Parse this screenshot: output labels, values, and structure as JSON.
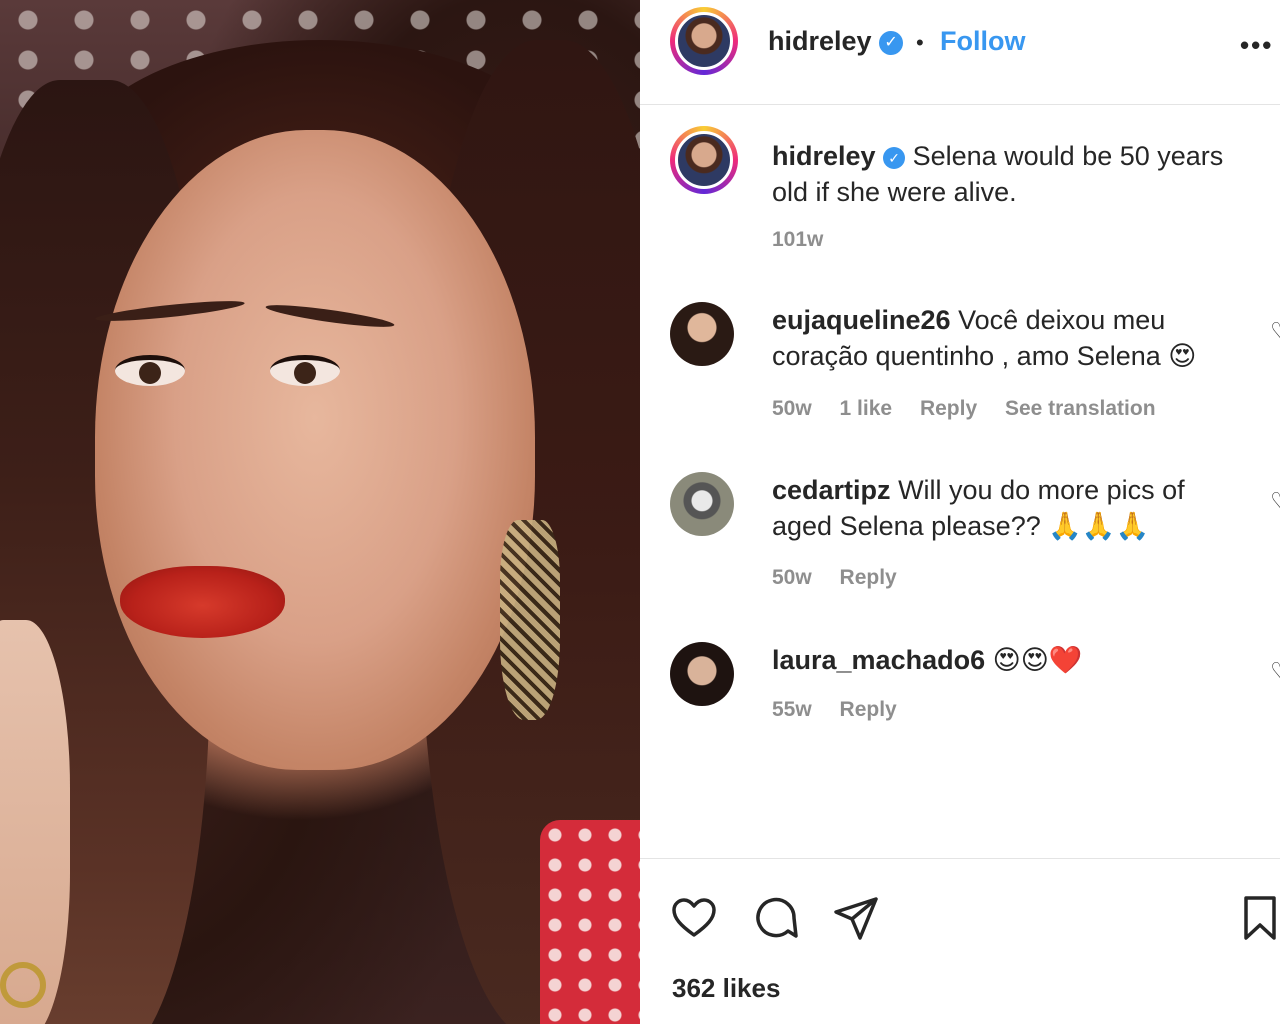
{
  "post": {
    "username": "hidreley",
    "follow_label": "Follow",
    "separator": "•",
    "more_label": "•••",
    "verified_glyph": "✓"
  },
  "caption": {
    "username": "hidreley",
    "text": "Selena would be 50 years old if she were alive.",
    "age": "101w"
  },
  "comments": [
    {
      "username": "eujaqueline26",
      "text": "Você deixou meu coração quentinho , amo Selena 😍",
      "age": "50w",
      "likes": "1 like",
      "reply": "Reply",
      "translate": "See translation"
    },
    {
      "username": "cedartipz",
      "text": "Will you do more pics of aged Selena please?? 🙏🙏🙏",
      "age": "50w",
      "reply": "Reply"
    },
    {
      "username": "laura_machado6",
      "text": "😍😍❤️",
      "age": "55w",
      "reply": "Reply"
    }
  ],
  "footer": {
    "likes_label": "362 likes"
  },
  "icons": {
    "like": "heart-icon",
    "comment": "comment-icon",
    "share": "share-icon",
    "save": "bookmark-icon"
  },
  "colors": {
    "accent": "#3897f0",
    "text": "#262626",
    "muted": "#8e8e8e"
  }
}
